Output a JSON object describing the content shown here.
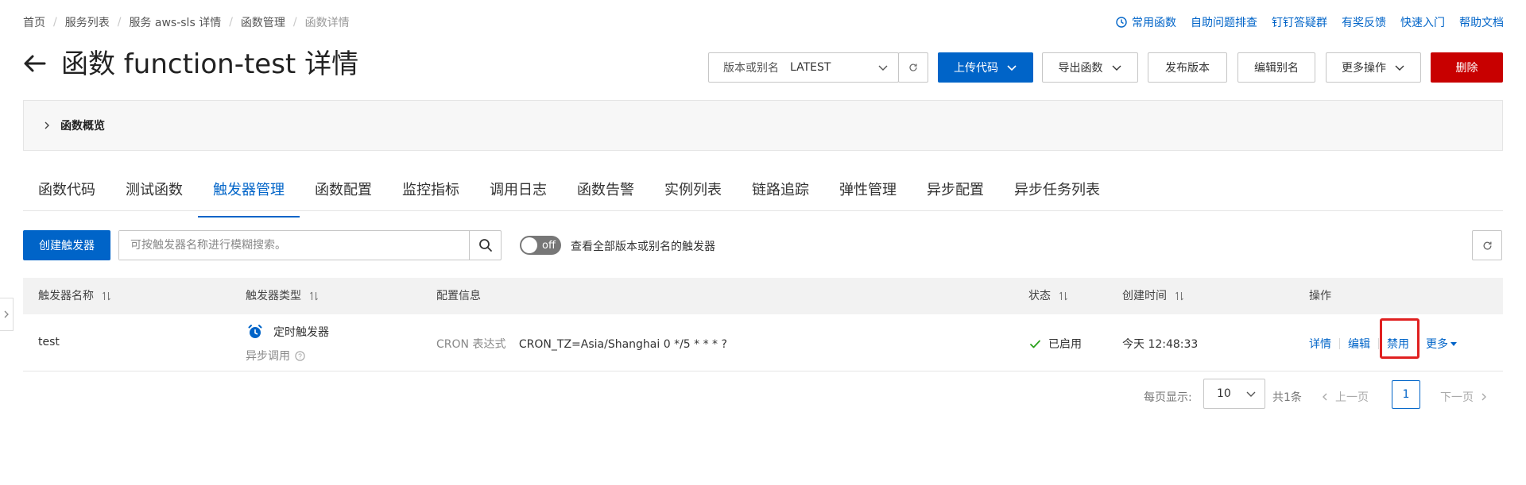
{
  "breadcrumb": [
    "首页",
    "服务列表",
    "服务 aws-sls 详情",
    "函数管理",
    "函数详情"
  ],
  "top_links": {
    "frequent": "常用函数",
    "self_check": "自助问题排查",
    "dingtalk": "钉钉答疑群",
    "feedback": "有奖反馈",
    "quickstart": "快速入门",
    "docs": "帮助文档"
  },
  "page_title": "函数 function-test 详情",
  "version_select": {
    "label": "版本或别名",
    "value": "LATEST"
  },
  "actions": {
    "upload_code": "上传代码",
    "export_function": "导出函数",
    "publish_version": "发布版本",
    "edit_alias": "编辑别名",
    "more_actions": "更多操作",
    "delete": "删除"
  },
  "overview_label": "函数概览",
  "tabs": [
    "函数代码",
    "测试函数",
    "触发器管理",
    "函数配置",
    "监控指标",
    "调用日志",
    "函数告警",
    "实例列表",
    "链路追踪",
    "弹性管理",
    "异步配置",
    "异步任务列表"
  ],
  "active_tab": "触发器管理",
  "toolbar": {
    "create_trigger": "创建触发器",
    "search_placeholder": "可按触发器名称进行模糊搜索。",
    "toggle_state": "off",
    "toggle_text": "查看全部版本或别名的触发器"
  },
  "table": {
    "columns": {
      "name": "触发器名称",
      "type": "触发器类型",
      "config": "配置信息",
      "status": "状态",
      "created": "创建时间",
      "ops": "操作"
    },
    "rows": [
      {
        "name": "test",
        "type": "定时触发器",
        "sub_type": "异步调用",
        "config_label": "CRON 表达式",
        "config_value": "CRON_TZ=Asia/Shanghai 0 */5 * * * ?",
        "status": "已启用",
        "created": "今天 12:48:33",
        "ops": {
          "detail": "详情",
          "edit": "编辑",
          "disable": "禁用",
          "more": "更多"
        }
      }
    ]
  },
  "pagination": {
    "per_page_label": "每页显示:",
    "per_page": "10",
    "total": "共1条",
    "prev": "上一页",
    "current": "1",
    "next": "下一页"
  },
  "colors": {
    "primary": "#0064c8",
    "danger": "#c80000",
    "success": "#2ba11c",
    "highlight": "#e02020"
  }
}
